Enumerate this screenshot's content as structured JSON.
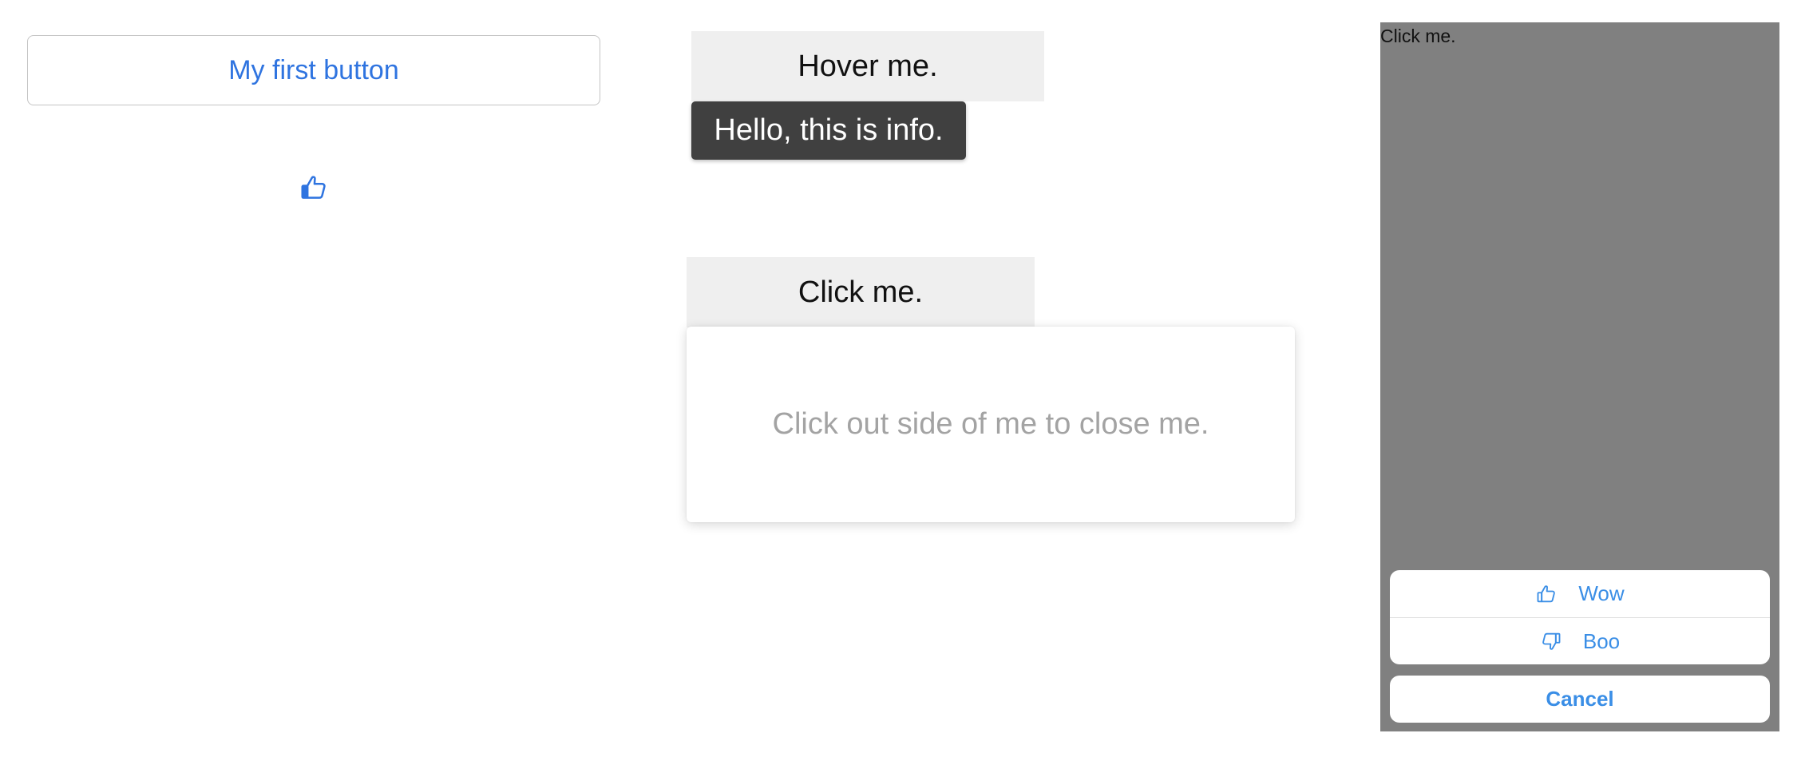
{
  "left_panel": {
    "first_button_label": "My first button",
    "like_icon": "thumbs-up-icon"
  },
  "hover_demo": {
    "trigger_label": "Hover me.",
    "tooltip_text": "Hello, this is info."
  },
  "click_demo": {
    "trigger_label": "Click me.",
    "popover_text": "Click out side of me to close me."
  },
  "device": {
    "trigger_label": "Click me.",
    "action_sheet": {
      "items": [
        {
          "label": "Wow",
          "icon": "thumbs-up-icon"
        },
        {
          "label": "Boo",
          "icon": "thumbs-down-icon"
        }
      ],
      "cancel_label": "Cancel"
    }
  },
  "colors": {
    "accent": "#2f74e0",
    "sheet_accent": "#3a8ee6",
    "tooltip_bg": "#404040",
    "overlay": "#808080"
  }
}
